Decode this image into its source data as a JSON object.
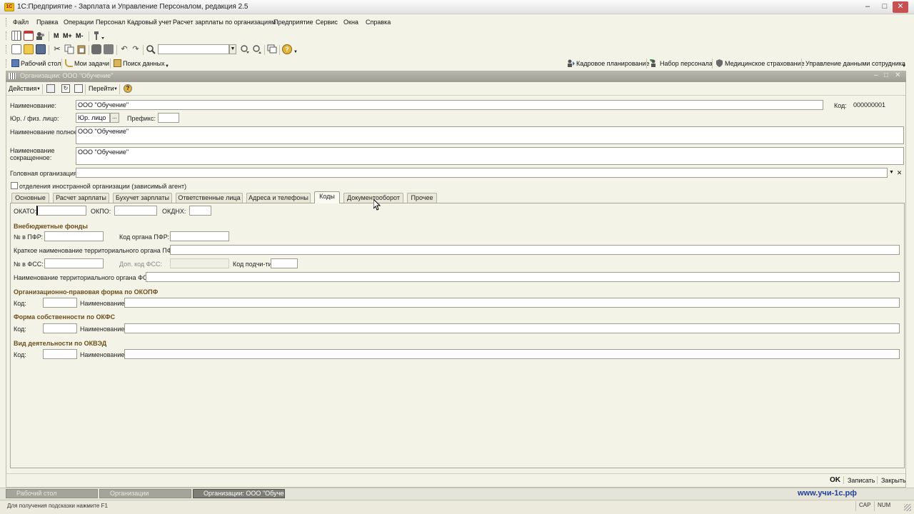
{
  "window": {
    "title": "1С:Предприятие - Зарплата и Управление Персоналом, редакция 2.5",
    "app_icon_text": "1C",
    "controls": [
      "minimize-icon",
      "maximize-icon",
      "close-icon"
    ]
  },
  "menu": [
    "Файл",
    "Правка",
    "Операции",
    "Персонал",
    "Кадровый учет",
    "Расчет зарплаты по организациям",
    "Предприятие",
    "Сервис",
    "Окна",
    "Справка"
  ],
  "toolbar1": {
    "buttons": [
      "calendar-icon",
      "grid-icon",
      "users-icon",
      "m-icon",
      "m-plus-icon",
      "m-minus-icon",
      "tools-icon"
    ],
    "labels": [
      "М",
      "М+",
      "М-"
    ]
  },
  "toolbar2": {
    "buttons": [
      "new-document-icon",
      "open-icon",
      "save-icon",
      "cut-icon",
      "copy-icon",
      "paste-icon",
      "print-icon",
      "print-preview-icon",
      "undo-icon",
      "redo-icon",
      "search-icon",
      "find-next-icon",
      "find-prev-icon",
      "windows-icon",
      "help-icon"
    ],
    "search_value": ""
  },
  "toolbar3": {
    "left": [
      "Рабочий стол",
      "Мои задачи",
      "Поиск данных"
    ],
    "right": [
      "Кадровое планирование",
      "Набор персонала",
      "Медицинское страхование",
      "Управление данными сотрудника"
    ]
  },
  "form": {
    "title": "Организации: ООО \"Обучение\"",
    "toolbar": {
      "actions": "Действия",
      "goto": "Перейти"
    },
    "labels": {
      "name": "Наименование:",
      "code": "Код:",
      "legal_type": "Юр. / физ. лицо:",
      "prefix": "Префикс:",
      "full_name": "Наименование полное:",
      "short_name": "Наименование сокращенное:",
      "head_org": "Головная организация:",
      "foreign_branch": "отделения иностранной организации (зависимый агент)"
    },
    "values": {
      "name": "ООО \"Обучение\"",
      "code": "000000001",
      "legal_type": "Юр. лицо",
      "prefix": "",
      "full_name": "ООО \"Обучение\"",
      "short_name": "ООО \"Обучение\"",
      "head_org": "",
      "ellipsis": "...",
      "foreign_branch_checked": false
    },
    "tabs": [
      "Основные",
      "Расчет зарплаты",
      "Бухучет зарплаты",
      "Ответственные лица",
      "Адреса и телефоны",
      "Коды",
      "Документооборот",
      "Прочее"
    ],
    "active_tab": "Коды",
    "codes": {
      "okato_label": "ОКАТО:",
      "okpo_label": "ОКПО:",
      "okdnh_label": "ОКДНХ:",
      "funds_section": "Внебюджетные фонды",
      "pfr_num_label": "№ в ПФР:",
      "pfr_org_code_label": "Код органа ПФР:",
      "pfr_territory_label": "Краткое наименование территориального органа ПФР:",
      "fss_num_label": "№ в ФСС:",
      "fss_add_code_label": "Доп. код ФСС:",
      "sub_code_label": "Код подчи-ти:",
      "fss_territory_label": "Наименование территориального органа ФСС:",
      "okopf_section": "Организационно-правовая форма по ОКОПФ",
      "okfs_section": "Форма собственности по ОКФС",
      "okved_section": "Вид деятельности по ОКВЭД",
      "code_label": "Код:",
      "name_label": "Наименование:"
    },
    "footer": {
      "ok": "OK",
      "write": "Записать",
      "close": "Закрыть"
    }
  },
  "taskbar": [
    "Рабочий стол",
    "Организации",
    "Организации: ООО \"Обучен..."
  ],
  "watermark": "www.учи-1с.рф",
  "statusbar": {
    "hint": "Для получения подсказки нажмите F1",
    "cap": "CAP",
    "num": "NUM"
  }
}
